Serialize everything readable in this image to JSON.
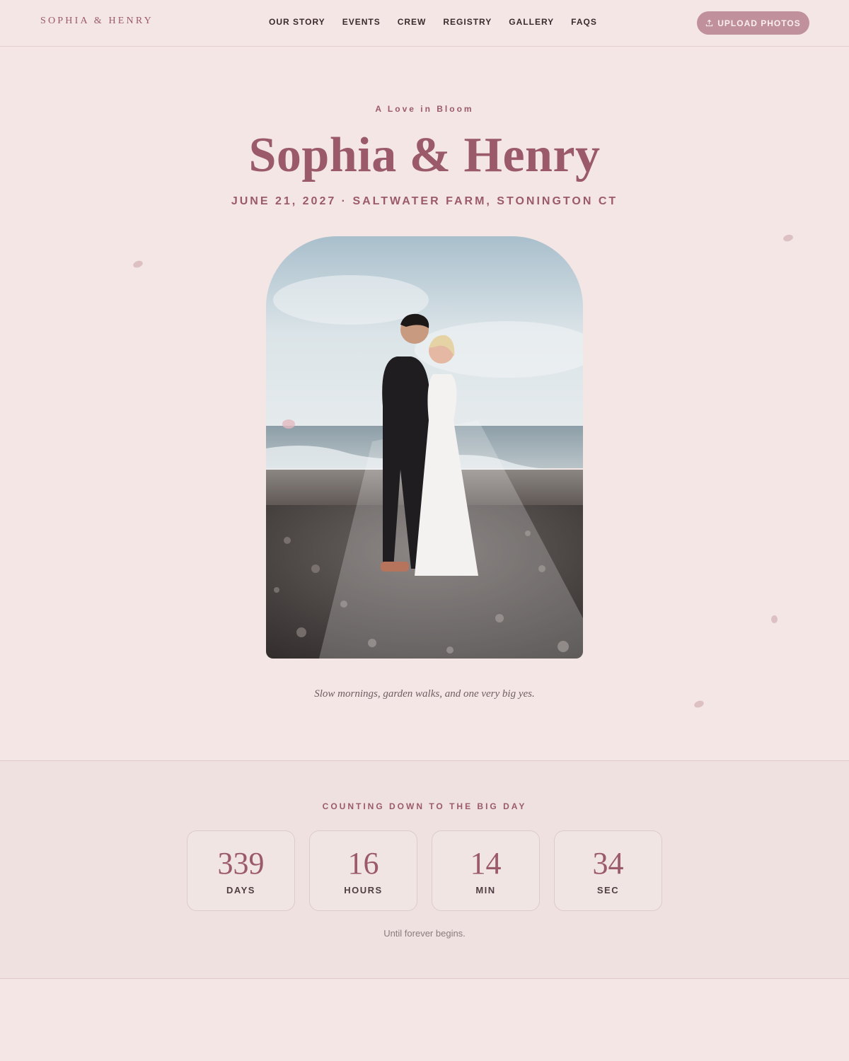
{
  "header": {
    "brand": "SOPHIA & HENRY",
    "nav": [
      "OUR STORY",
      "EVENTS",
      "CREW",
      "REGISTRY",
      "GALLERY",
      "FAQS"
    ],
    "upload_label": "UPLOAD PHOTOS",
    "upload_icon": "upload-icon"
  },
  "hero": {
    "tagline": "A Love in Bloom",
    "title": "Sophia & Henry",
    "event_line": "JUNE 21, 2027 · SALTWATER FARM, STONINGTON CT",
    "photo": "couple-on-beach-photo",
    "caption": "Slow mornings, garden walks, and one very big yes."
  },
  "countdown": {
    "heading": "COUNTING DOWN TO THE BIG DAY",
    "units": [
      {
        "value": "339",
        "label": "DAYS"
      },
      {
        "value": "16",
        "label": "HOURS"
      },
      {
        "value": "14",
        "label": "MIN"
      },
      {
        "value": "34",
        "label": "SEC"
      }
    ],
    "footer": "Until forever begins."
  },
  "colors": {
    "background": "#f3e6e5",
    "accent": "#9b5a6a",
    "button": "#c0909c"
  }
}
